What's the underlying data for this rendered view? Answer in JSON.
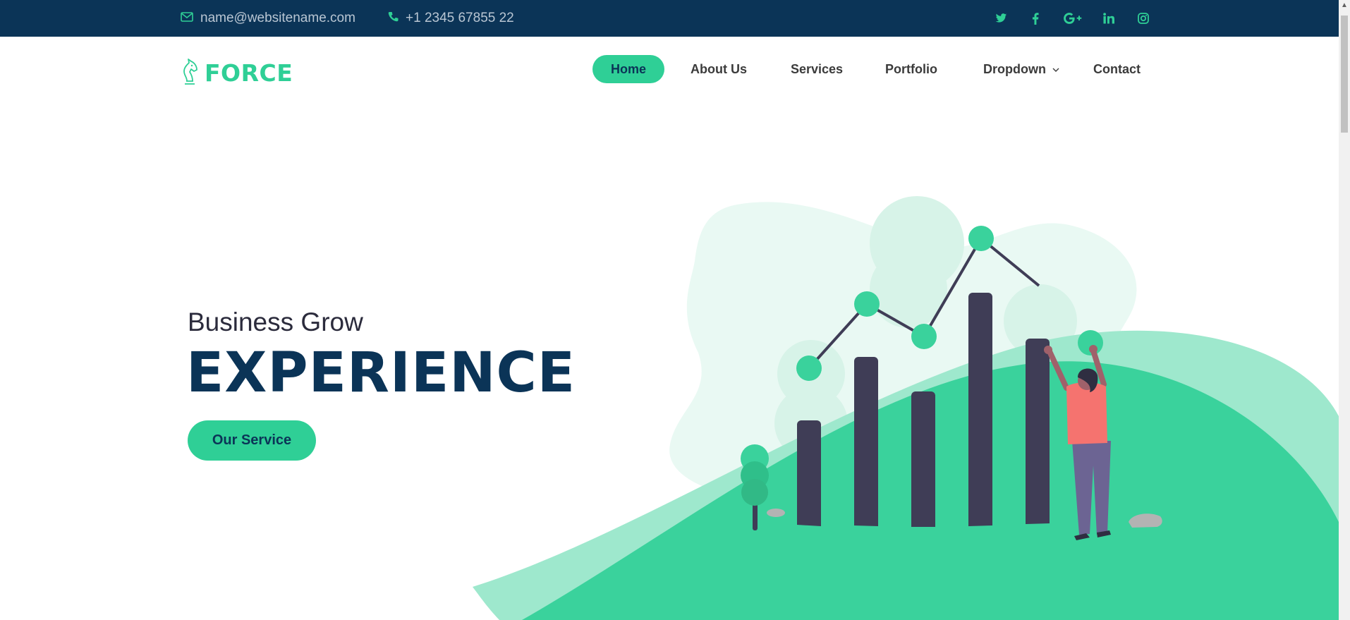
{
  "topbar": {
    "email": "name@websitename.com",
    "phone": "+1 2345 67855 22",
    "email_icon": "envelope-icon",
    "phone_icon": "phone-icon",
    "social_icons": [
      "twitter-icon",
      "facebook-icon",
      "google-plus-icon",
      "linkedin-icon",
      "instagram-icon"
    ]
  },
  "brand": {
    "name": "FORCE",
    "logo_icon": "chess-knight-icon"
  },
  "nav": {
    "items": [
      {
        "label": "Home",
        "active": true
      },
      {
        "label": "About Us",
        "active": false
      },
      {
        "label": "Services",
        "active": false
      },
      {
        "label": "Portfolio",
        "active": false
      },
      {
        "label": "Dropdown",
        "active": false
      },
      {
        "label": "Contact",
        "active": false
      }
    ]
  },
  "hero": {
    "subtitle": "Business Grow",
    "title": "EXPERIENCE",
    "button_label": "Our Service"
  },
  "colors": {
    "navy": "#0b3457",
    "accent": "#2fcf96",
    "bar": "#3f3d56",
    "person_shirt": "#f5736f"
  }
}
